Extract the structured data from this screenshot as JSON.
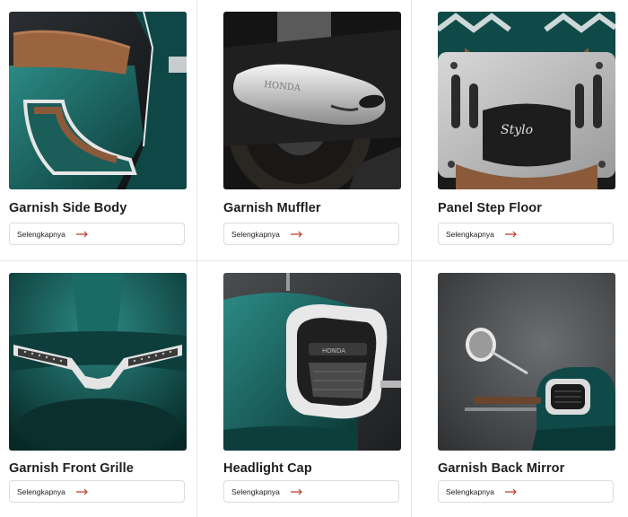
{
  "products": [
    {
      "title": "Garnish Side Body",
      "link_label": "Selengkapnya"
    },
    {
      "title": "Garnish Muffler",
      "link_label": "Selengkapnya",
      "image_text": "HONDA"
    },
    {
      "title": "Panel Step Floor",
      "link_label": "Selengkapnya",
      "image_text": "Stylo"
    },
    {
      "title": "Garnish Front Grille",
      "link_label": "Selengkapnya"
    },
    {
      "title": "Headlight Cap",
      "link_label": "Selengkapnya",
      "image_text": "HONDA"
    },
    {
      "title": "Garnish Back Mirror",
      "link_label": "Selengkapnya"
    }
  ],
  "colors": {
    "teal": "#0f4a48",
    "teal_light": "#2c8a85",
    "brown": "#8a5a3a",
    "arrow": "#c0392b",
    "chrome": "#d8d8d8"
  }
}
